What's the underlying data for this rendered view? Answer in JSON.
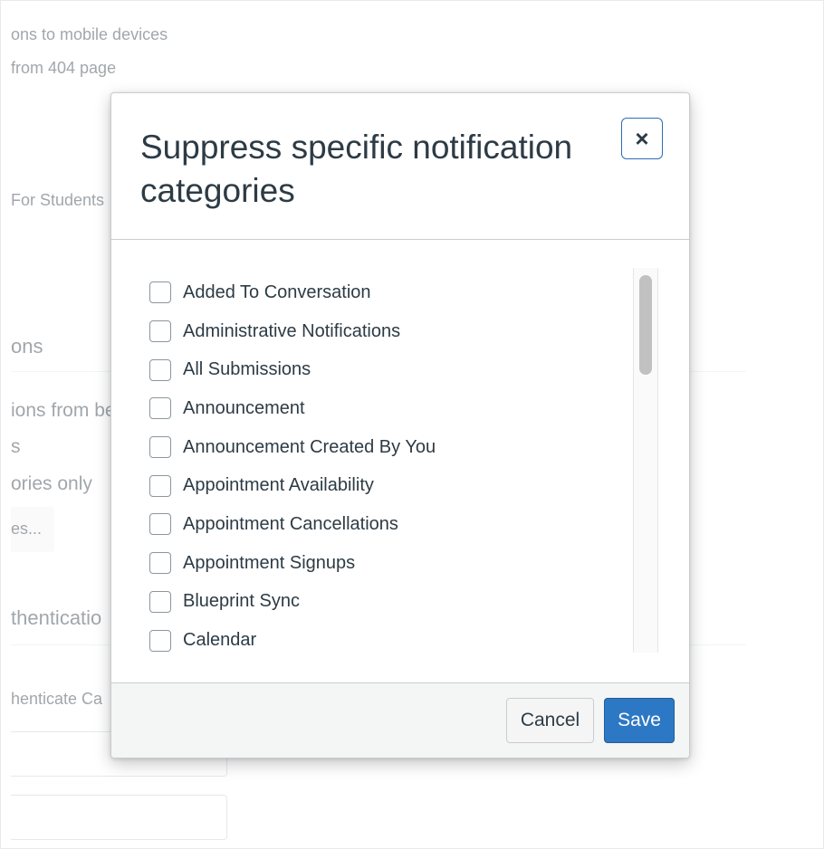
{
  "background": {
    "line1": "ons to mobile devices",
    "line2": "from 404 page",
    "line3": "For Students",
    "heading1": "ons",
    "line4": "ions from be",
    "line5": "s",
    "line6": "ories only",
    "button_partial": "es...",
    "heading2": "thenticatio",
    "field_label": "henticate Ca"
  },
  "modal": {
    "title": "Suppress specific notification categories",
    "close_label": "×",
    "options": [
      {
        "label": "Added To Conversation",
        "checked": false
      },
      {
        "label": "Administrative Notifications",
        "checked": false
      },
      {
        "label": "All Submissions",
        "checked": false
      },
      {
        "label": "Announcement",
        "checked": false
      },
      {
        "label": "Announcement Created By You",
        "checked": false
      },
      {
        "label": "Appointment Availability",
        "checked": false
      },
      {
        "label": "Appointment Cancellations",
        "checked": false
      },
      {
        "label": "Appointment Signups",
        "checked": false
      },
      {
        "label": "Blueprint Sync",
        "checked": false
      },
      {
        "label": "Calendar",
        "checked": false
      }
    ],
    "footer": {
      "cancel_label": "Cancel",
      "save_label": "Save"
    }
  },
  "colors": {
    "primary": "#2d78c4",
    "text": "#2d3b45",
    "border": "#c7cdd1"
  }
}
